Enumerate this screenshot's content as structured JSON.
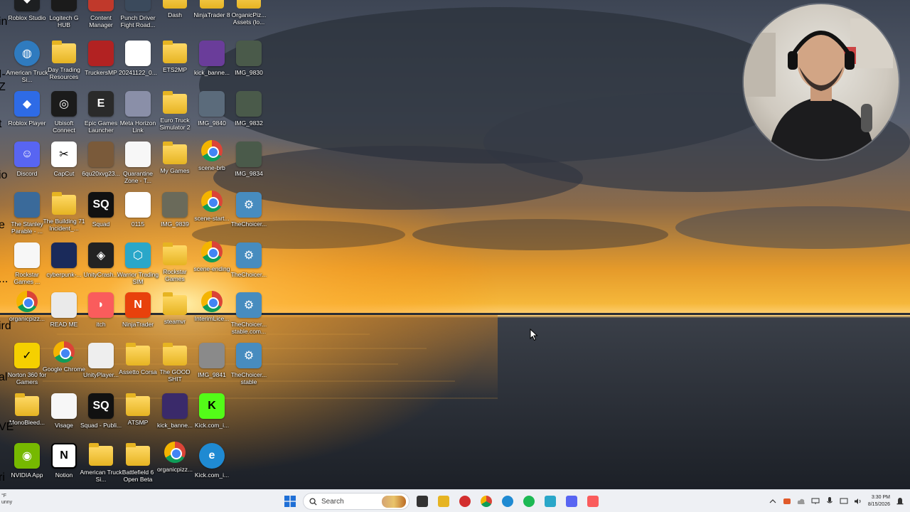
{
  "desktop": {
    "icons": [
      {
        "label": "Roblox Studio",
        "icon": "roblox-studio-icon",
        "color": "#1d1f21"
      },
      {
        "label": "Logitech G HUB",
        "icon": "logitech-icon",
        "color": "#1b1b1b"
      },
      {
        "label": "Content Manager",
        "icon": "content-manager-icon",
        "color": "#c0392b"
      },
      {
        "label": "Punch Driver Fight Road...",
        "icon": "game-icon",
        "color": "#3b4a5c"
      },
      {
        "label": "Dash",
        "icon": "folder-icon",
        "color": "#e6b422"
      },
      {
        "label": "NinjaTrader 8",
        "icon": "folder-icon",
        "color": "#e6b422"
      },
      {
        "label": "OrganicPiz... Assets (lo...",
        "icon": "folder-icon",
        "color": "#e6b422"
      },
      {
        "label": "American Truck Si...",
        "icon": "globe-icon",
        "color": "#2f7bbf"
      },
      {
        "label": "Day Trading Resources",
        "icon": "folder-icon",
        "color": "#e6b422"
      },
      {
        "label": "TruckersMP",
        "icon": "truckersmp-icon",
        "color": "#b22222"
      },
      {
        "label": "20241122_0...",
        "icon": "video-file-icon",
        "color": "#ffffff"
      },
      {
        "label": "ETS2MP",
        "icon": "folder-icon",
        "color": "#e6b422"
      },
      {
        "label": "kick_banne...",
        "icon": "image-file-icon",
        "color": "#6a3d9a"
      },
      {
        "label": "IMG_9830",
        "icon": "photo-icon",
        "color": "#4a5a4a"
      },
      {
        "label": "Roblox Player",
        "icon": "roblox-icon",
        "color": "#2e6be6"
      },
      {
        "label": "Ubisoft Connect",
        "icon": "ubisoft-icon",
        "color": "#1b1b1b"
      },
      {
        "label": "Epic Games Launcher",
        "icon": "epic-games-icon",
        "color": "#2a2a2a"
      },
      {
        "label": "Meta Horizon Link",
        "icon": "vr-headset-icon",
        "color": "#8a8fa8"
      },
      {
        "label": "Euro Truck Simulator 2",
        "icon": "folder-icon",
        "color": "#e6b422"
      },
      {
        "label": "IMG_9840",
        "icon": "photo-icon",
        "color": "#5b6b7b"
      },
      {
        "label": "IMG_9832",
        "icon": "photo-icon",
        "color": "#4a5a4a"
      },
      {
        "label": "Discord",
        "icon": "discord-icon",
        "color": "#5865f2"
      },
      {
        "label": "CapCut",
        "icon": "capcut-icon",
        "color": "#ffffff"
      },
      {
        "label": "6qu20xvg23...",
        "icon": "image-file-icon",
        "color": "#7a5a3a"
      },
      {
        "label": "Quarantine Zone - T...",
        "icon": "file-icon",
        "color": "#f7f7f7"
      },
      {
        "label": "My Games",
        "icon": "folder-icon",
        "color": "#e6b422"
      },
      {
        "label": "scene-brb",
        "icon": "chrome-icon",
        "color": "#4285f4"
      },
      {
        "label": "IMG_9834",
        "icon": "photo-icon",
        "color": "#4a5a4a"
      },
      {
        "label": "The Stanley Parable - ...",
        "icon": "game-icon",
        "color": "#3a6a9a"
      },
      {
        "label": "The Building 71 Incident_...",
        "icon": "folder-icon",
        "color": "#e6b422"
      },
      {
        "label": "Squad",
        "icon": "squad-icon",
        "color": "#111111"
      },
      {
        "label": "0115",
        "icon": "video-file-icon",
        "color": "#ffffff"
      },
      {
        "label": "IMG_9839",
        "icon": "photo-icon",
        "color": "#6a6a5a"
      },
      {
        "label": "scene-start...",
        "icon": "chrome-icon",
        "color": "#4285f4"
      },
      {
        "label": "TheChoicer...",
        "icon": "godot-icon",
        "color": "#478cbf"
      },
      {
        "label": "Rockstar Games ...",
        "icon": "file-icon",
        "color": "#f7f7f7"
      },
      {
        "label": "cyberpunk-...",
        "icon": "image-file-icon",
        "color": "#1a2a5a"
      },
      {
        "label": "UnityCrash...",
        "icon": "unity-icon",
        "color": "#222222"
      },
      {
        "label": "Warrior Trading SIM",
        "icon": "warrior-trading-icon",
        "color": "#2aa7c9"
      },
      {
        "label": "Rockstar Games",
        "icon": "folder-icon",
        "color": "#e6b422"
      },
      {
        "label": "scene-ending",
        "icon": "chrome-icon",
        "color": "#4285f4"
      },
      {
        "label": "TheChoicer...",
        "icon": "godot-icon",
        "color": "#478cbf"
      },
      {
        "label": "organicpizz...",
        "icon": "chrome-icon",
        "color": "#4285f4"
      },
      {
        "label": "READ ME",
        "icon": "text-file-icon",
        "color": "#eaeaea"
      },
      {
        "label": "itch",
        "icon": "itch-icon",
        "color": "#fa5c5c"
      },
      {
        "label": "NinjaTrader",
        "icon": "ninjatrader-icon",
        "color": "#e8410c"
      },
      {
        "label": "steamvr",
        "icon": "folder-icon",
        "color": "#e6b422"
      },
      {
        "label": "InterimLice...",
        "icon": "chrome-icon",
        "color": "#4285f4"
      },
      {
        "label": "TheChoicer... stable.com...",
        "icon": "godot-icon",
        "color": "#478cbf"
      },
      {
        "label": "Norton 360 for Gamers",
        "icon": "norton-icon",
        "color": "#f5d000"
      },
      {
        "label": "Google Chrome",
        "icon": "chrome-icon",
        "color": "#4285f4"
      },
      {
        "label": "UnityPlayer...",
        "icon": "gear-file-icon",
        "color": "#eeeeee"
      },
      {
        "label": "Assetto Corsa",
        "icon": "folder-icon",
        "color": "#e6b422"
      },
      {
        "label": "The GOOD SHIT",
        "icon": "folder-icon",
        "color": "#e6b422"
      },
      {
        "label": "IMG_9841",
        "icon": "photo-icon",
        "color": "#8a8a8a"
      },
      {
        "label": "TheChoicer... stable",
        "icon": "godot-icon",
        "color": "#478cbf"
      },
      {
        "label": "MonoBleed...",
        "icon": "folder-icon",
        "color": "#e6b422"
      },
      {
        "label": "Visage",
        "icon": "file-icon",
        "color": "#f7f7f7"
      },
      {
        "label": "Squad - Publi...",
        "icon": "squad-icon",
        "color": "#111111"
      },
      {
        "label": "ATSMP",
        "icon": "folder-icon",
        "color": "#e6b422"
      },
      {
        "label": "kick_banne...",
        "icon": "image-file-icon",
        "color": "#3a2a6a"
      },
      {
        "label": "Kick.com_i...",
        "icon": "kick-icon",
        "color": "#53fc18"
      },
      {
        "label": "NVIDIA App",
        "icon": "nvidia-icon",
        "color": "#76b900"
      },
      {
        "label": "Notion",
        "icon": "notion-icon",
        "color": "#ffffff"
      },
      {
        "label": "American Truck Si...",
        "icon": "folder-icon",
        "color": "#e6b422"
      },
      {
        "label": "Battlefield 6 Open Beta",
        "icon": "folder-icon",
        "color": "#e6b422"
      },
      {
        "label": "organicpizz...",
        "icon": "chrome-icon",
        "color": "#4285f4"
      },
      {
        "label": "Kick.com_i...",
        "icon": "edge-icon",
        "color": "#1f8ad2"
      }
    ],
    "partial_left_labels": [
      "in",
      "I-Z",
      "t",
      "io",
      "e",
      "...",
      "ird",
      "al",
      "VE",
      "ri"
    ]
  },
  "taskbar": {
    "weather_line1": "°F",
    "weather_line2": "unny",
    "search_placeholder": "Search",
    "pinned": [
      {
        "name": "task-view-button",
        "icon": "task-view-icon",
        "color": "#333333"
      },
      {
        "name": "file-explorer-button",
        "icon": "folder-icon",
        "color": "#e6b422"
      },
      {
        "name": "obs-button",
        "icon": "record-icon",
        "color": "#d32f2f"
      },
      {
        "name": "chrome-taskbar-button",
        "icon": "chrome-icon",
        "color": "#4285f4"
      },
      {
        "name": "edge-taskbar-button",
        "icon": "edge-icon",
        "color": "#1f8ad2"
      },
      {
        "name": "spotify-button",
        "icon": "spotify-icon",
        "color": "#1db954"
      },
      {
        "name": "shield-app-button",
        "icon": "shield-icon",
        "color": "#2aa7c9"
      },
      {
        "name": "discord-taskbar-button",
        "icon": "discord-icon",
        "color": "#5865f2"
      },
      {
        "name": "itch-taskbar-button",
        "icon": "itch-icon",
        "color": "#fa5c5c"
      }
    ],
    "time": "3:30 PM",
    "date": "8/15/2026"
  },
  "colors": {
    "taskbar_bg": "#eef0f4",
    "windows_blue": "#1f6fd6"
  }
}
